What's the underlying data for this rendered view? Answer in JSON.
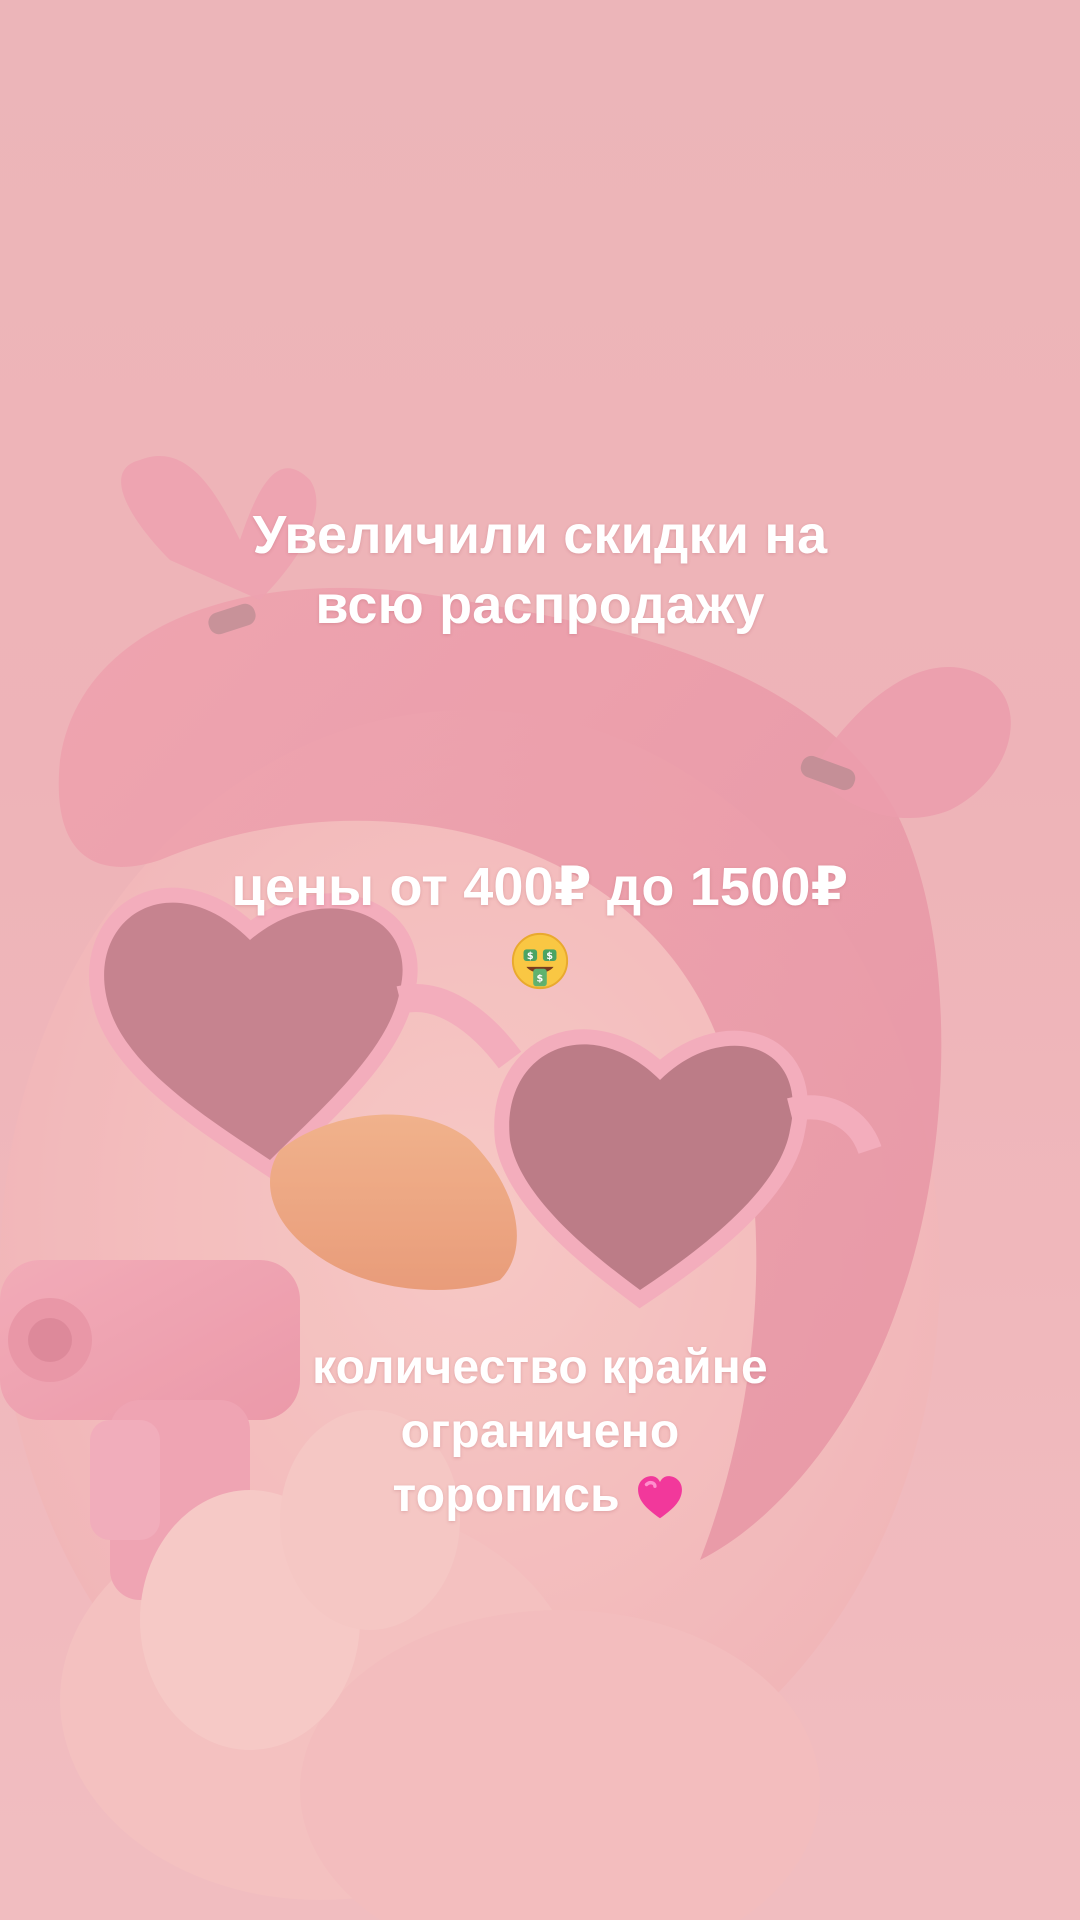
{
  "story": {
    "background_color": "#ecb4b8",
    "photo": {
      "subject": "pink-plush-duck-with-heart-sunglasses-plastic-bag-and-toy-pistol",
      "dominant_colors": [
        "#f2b9bf",
        "#e68a9c",
        "#b87a84",
        "#f0a36d"
      ]
    },
    "headline": {
      "line1": "Увеличили скидки на",
      "line2": "всю распродажу"
    },
    "prices": {
      "line1": "цены от 400₽ до 1500₽",
      "emoji_icon": "money-mouth-face-icon"
    },
    "urgency": {
      "line1": "количество крайне",
      "line2": "ограничено",
      "line3": "торопись",
      "emoji_icon": "pink-heart-icon"
    }
  }
}
